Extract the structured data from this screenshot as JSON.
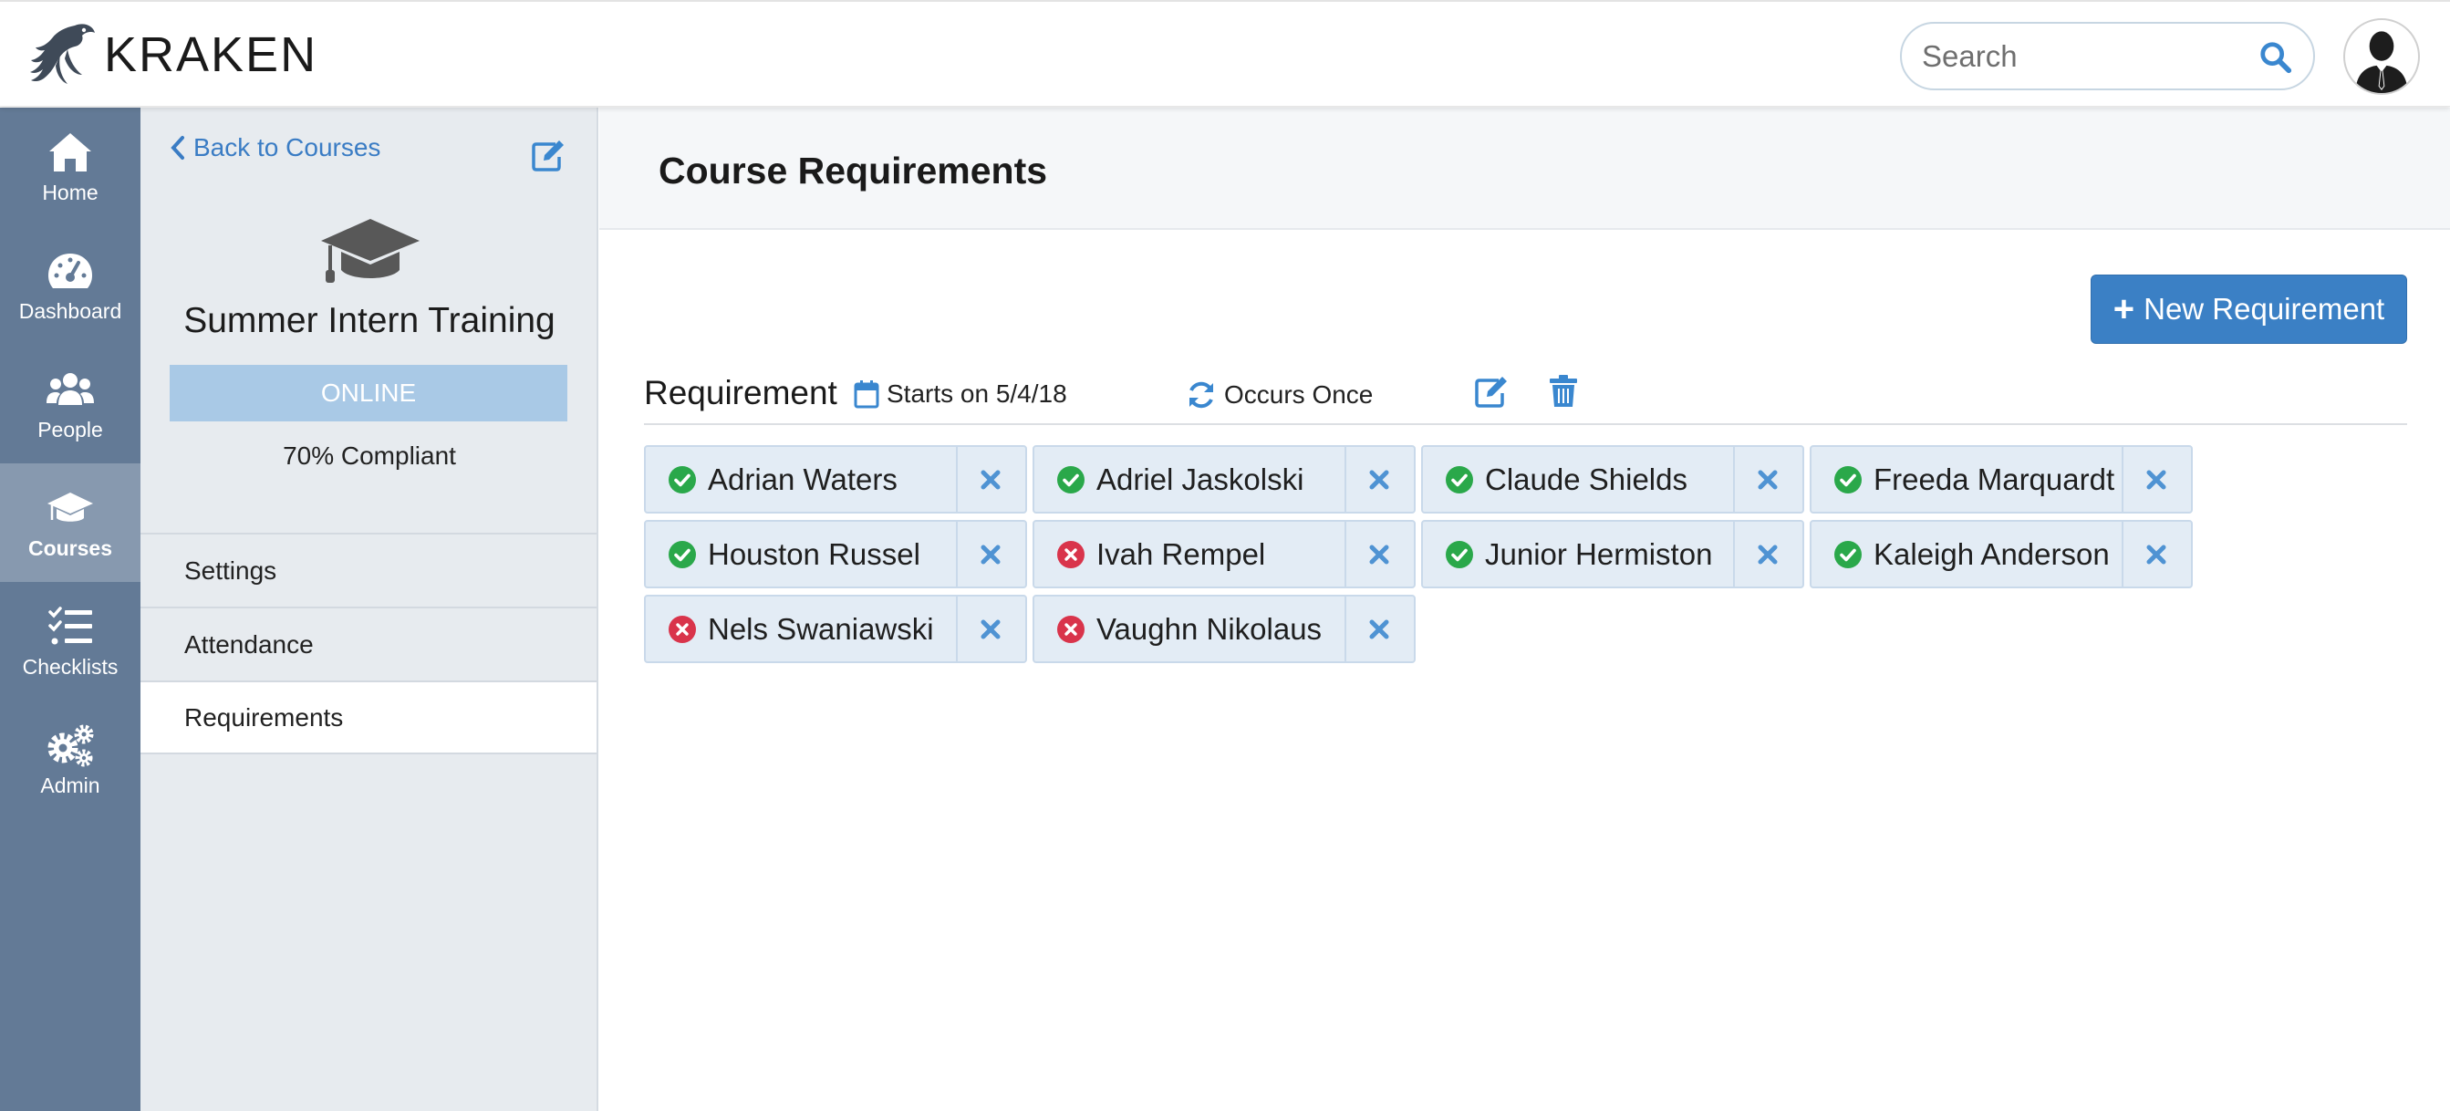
{
  "app": {
    "name": "KRAKEN"
  },
  "search": {
    "placeholder": "Search"
  },
  "nav": {
    "items": [
      {
        "label": "Home",
        "icon": "home-icon"
      },
      {
        "label": "Dashboard",
        "icon": "dashboard-icon"
      },
      {
        "label": "People",
        "icon": "people-icon"
      },
      {
        "label": "Courses",
        "icon": "graduation-cap-icon",
        "active": true
      },
      {
        "label": "Checklists",
        "icon": "checklist-icon"
      },
      {
        "label": "Admin",
        "icon": "gears-icon"
      }
    ]
  },
  "course": {
    "back_label": "Back to Courses",
    "title": "Summer Intern Training",
    "mode": "ONLINE",
    "compliance": "70% Compliant",
    "menu": [
      {
        "label": "Settings"
      },
      {
        "label": "Attendance"
      },
      {
        "label": "Requirements",
        "selected": true
      }
    ]
  },
  "page": {
    "title": "Course Requirements",
    "new_button": "New Requirement"
  },
  "requirement": {
    "label": "Requirement",
    "start": "Starts on 5/4/18",
    "occurs": "Occurs Once",
    "people": [
      {
        "name": "Adrian Waters",
        "status": "complete"
      },
      {
        "name": "Adriel Jaskolski",
        "status": "complete"
      },
      {
        "name": "Claude Shields",
        "status": "complete"
      },
      {
        "name": "Freeda Marquardt",
        "status": "complete"
      },
      {
        "name": "Houston Russel",
        "status": "complete"
      },
      {
        "name": "Ivah Rempel",
        "status": "incomplete"
      },
      {
        "name": "Junior Hermiston",
        "status": "complete"
      },
      {
        "name": "Kaleigh Anderson",
        "status": "complete"
      },
      {
        "name": "Nels Swaniawski",
        "status": "incomplete"
      },
      {
        "name": "Vaughn Nikolaus",
        "status": "incomplete"
      }
    ]
  },
  "colors": {
    "nav_bg": "#637a96",
    "accent": "#3b80c5",
    "complete": "#2aa84a",
    "incomplete": "#d9344b"
  }
}
